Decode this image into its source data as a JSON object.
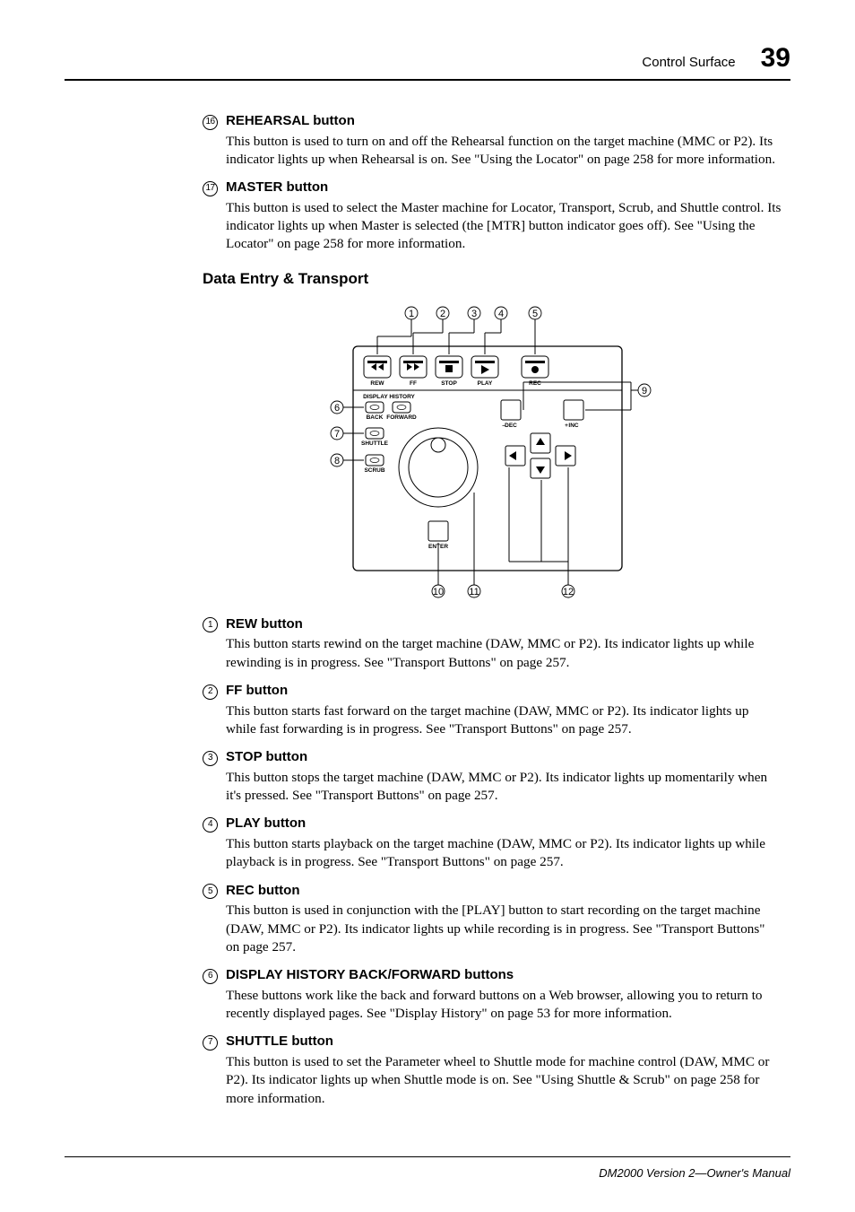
{
  "header": {
    "section": "Control Surface",
    "page": "39"
  },
  "footer": "DM2000 Version 2—Owner's Manual",
  "h2": "Data Entry & Transport",
  "items_top": [
    {
      "marker": "P",
      "marker_num": "16",
      "title": "REHEARSAL button",
      "body": "This button is used to turn on and off the Rehearsal function on the target machine (MMC or P2). Its indicator lights up when Rehearsal is on. See \"Using the Locator\" on page 258 for more information."
    },
    {
      "marker": "Q",
      "marker_num": "17",
      "title": "MASTER button",
      "body": "This button is used to select the Master machine for Locator, Transport, Scrub, and Shuttle control. Its indicator lights up when Master is selected (the [MTR] button indicator goes off). See \"Using the Locator\" on page 258 for more information."
    }
  ],
  "items_bottom": [
    {
      "marker": "A",
      "marker_num": "1",
      "title": "REW button",
      "body": "This button starts rewind on the target machine (DAW, MMC or P2). Its indicator lights up while rewinding is in progress. See \"Transport Buttons\" on page 257."
    },
    {
      "marker": "B",
      "marker_num": "2",
      "title": "FF button",
      "body": "This button starts fast forward on the target machine (DAW, MMC or P2). Its indicator lights up while fast forwarding is in progress. See \"Transport Buttons\" on page 257."
    },
    {
      "marker": "C",
      "marker_num": "3",
      "title": "STOP button",
      "body": "This button stops the target machine (DAW, MMC or P2). Its indicator lights up momentarily when it's pressed. See \"Transport Buttons\" on page 257."
    },
    {
      "marker": "D",
      "marker_num": "4",
      "title": "PLAY button",
      "body": "This button starts playback on the target machine (DAW, MMC or P2). Its indicator lights up while playback is in progress. See \"Transport Buttons\" on page 257."
    },
    {
      "marker": "E",
      "marker_num": "5",
      "title": "REC button",
      "body": "This button is used in conjunction with the [PLAY] button to start recording on the target machine (DAW, MMC or P2). Its indicator lights up while recording is in progress. See \"Transport Buttons\" on page 257."
    },
    {
      "marker": "F",
      "marker_num": "6",
      "title": "DISPLAY HISTORY BACK/FORWARD buttons",
      "body": "These buttons work like the back and forward buttons on a Web browser, allowing you to return to recently displayed pages. See \"Display History\" on page 53 for more information."
    },
    {
      "marker": "G",
      "marker_num": "7",
      "title": "SHUTTLE button",
      "body": "This button is used to set the Parameter wheel to Shuttle mode for machine control (DAW, MMC or P2). Its indicator lights up when Shuttle mode is on. See \"Using Shuttle & Scrub\" on page 258 for more information."
    }
  ],
  "diagram": {
    "labels": {
      "rew": "REW",
      "ff": "FF",
      "stop": "STOP",
      "play": "PLAY",
      "rec": "REC",
      "disp_hist": "DISPLAY HISTORY",
      "back": "BACK",
      "forward": "FORWARD",
      "shuttle": "SHUTTLE",
      "scrub": "SCRUB",
      "enter": "ENTER",
      "dec": "DEC",
      "inc": "INC",
      "dec_minus": "–",
      "inc_plus": "+"
    },
    "callouts": {
      "1": "1",
      "2": "2",
      "3": "3",
      "4": "4",
      "5": "5",
      "6": "6",
      "7": "7",
      "8": "8",
      "9": "9",
      "10": "10",
      "11": "11",
      "12": "12"
    }
  }
}
